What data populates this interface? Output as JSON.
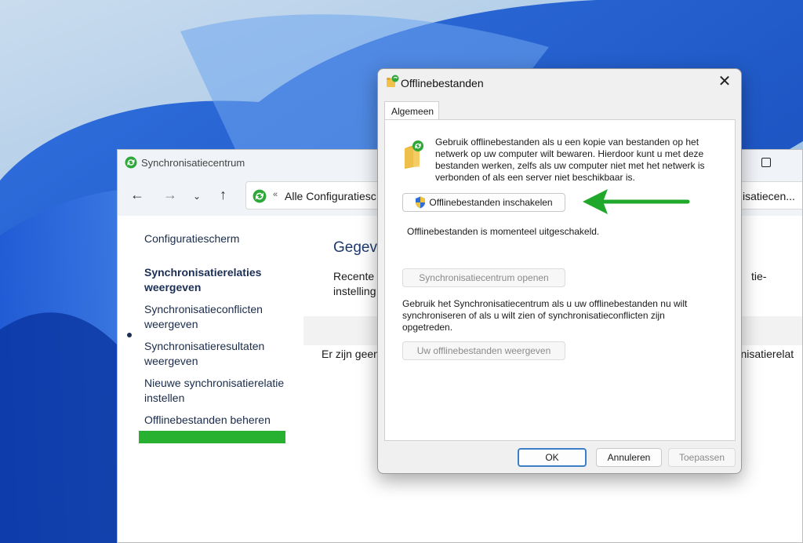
{
  "main_window": {
    "title": "Synchronisatiecentrum",
    "address_text": "Alle Configuratiesc",
    "address_separator": "«",
    "search_text": "isatiecen...",
    "nav": {
      "back": "←",
      "forward": "→",
      "recent": "⌄",
      "up": "↑"
    },
    "sidebar": {
      "home": "Configuratiescherm",
      "items": [
        "Synchronisatierelaties weergeven",
        "Synchronisatieconflicten weergeven",
        "Synchronisatieresultaten weergeven",
        "Nieuwe synchronisatierelatie instellen",
        "Offlinebestanden beheren"
      ],
      "active_index": 0
    },
    "content": {
      "heading": "Gegev",
      "desc_left": "Recente s instelling",
      "desc_right": "tie-",
      "empty_left": "Er zijn geen",
      "empty_right": "ronisatierelat"
    }
  },
  "dialog": {
    "title": "Offlinebestanden",
    "close_label": "✕",
    "tab_label": "Algemeen",
    "intro": "Gebruik offlinebestanden als u een kopie van bestanden op het netwerk op uw computer wilt bewaren. Hierdoor kunt u met deze bestanden werken, zelfs als uw computer niet met het netwerk is verbonden of als een server niet beschikbaar is.",
    "enable_button": "Offlinebestanden inschakelen",
    "status": "Offlinebestanden is momenteel uitgeschakeld.",
    "open_sync_button": "Synchronisatiecentrum openen",
    "sync_description": "Gebruik het Synchronisatiecentrum als u uw offlinebestanden nu wilt synchroniseren of als u wilt zien of synchronisatieconflicten zijn opgetreden.",
    "view_files_button": "Uw offlinebestanden weergeven",
    "ok_button": "OK",
    "cancel_button": "Annuleren",
    "apply_button": "Toepassen"
  },
  "colors": {
    "highlight_green": "#28b130",
    "arrow_green": "#1fa82a",
    "heading_blue": "#1e3a6e"
  },
  "icons": [
    "sync-icon",
    "folder-sync-icon",
    "shield-icon",
    "close-icon",
    "arrow-icon",
    "maximize-icon"
  ]
}
